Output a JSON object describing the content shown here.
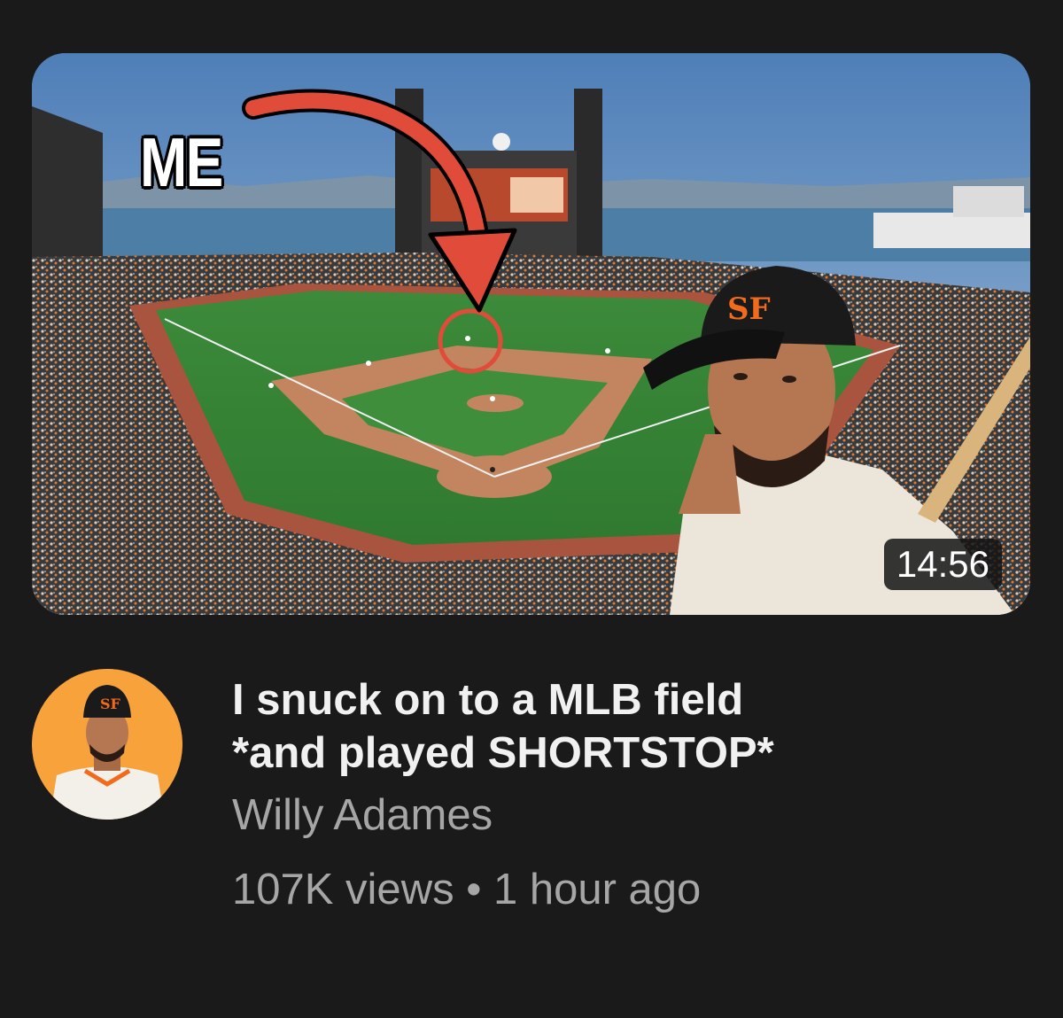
{
  "video": {
    "thumbnail_caption": "ME",
    "duration": "14:56",
    "title_line1": "I snuck on to a MLB field",
    "title_line2": "*and played SHORTSTOP*",
    "channel": "Willy Adames",
    "views": "107K views",
    "separator": "•",
    "age": "1 hour ago"
  },
  "colors": {
    "background": "#1a1a1a",
    "title": "#f1f1f1",
    "secondary": "#a6a6a6",
    "arrow": "#e04b3a",
    "avatar_bg": "#f7a23b",
    "giants_orange": "#f26b1d"
  }
}
